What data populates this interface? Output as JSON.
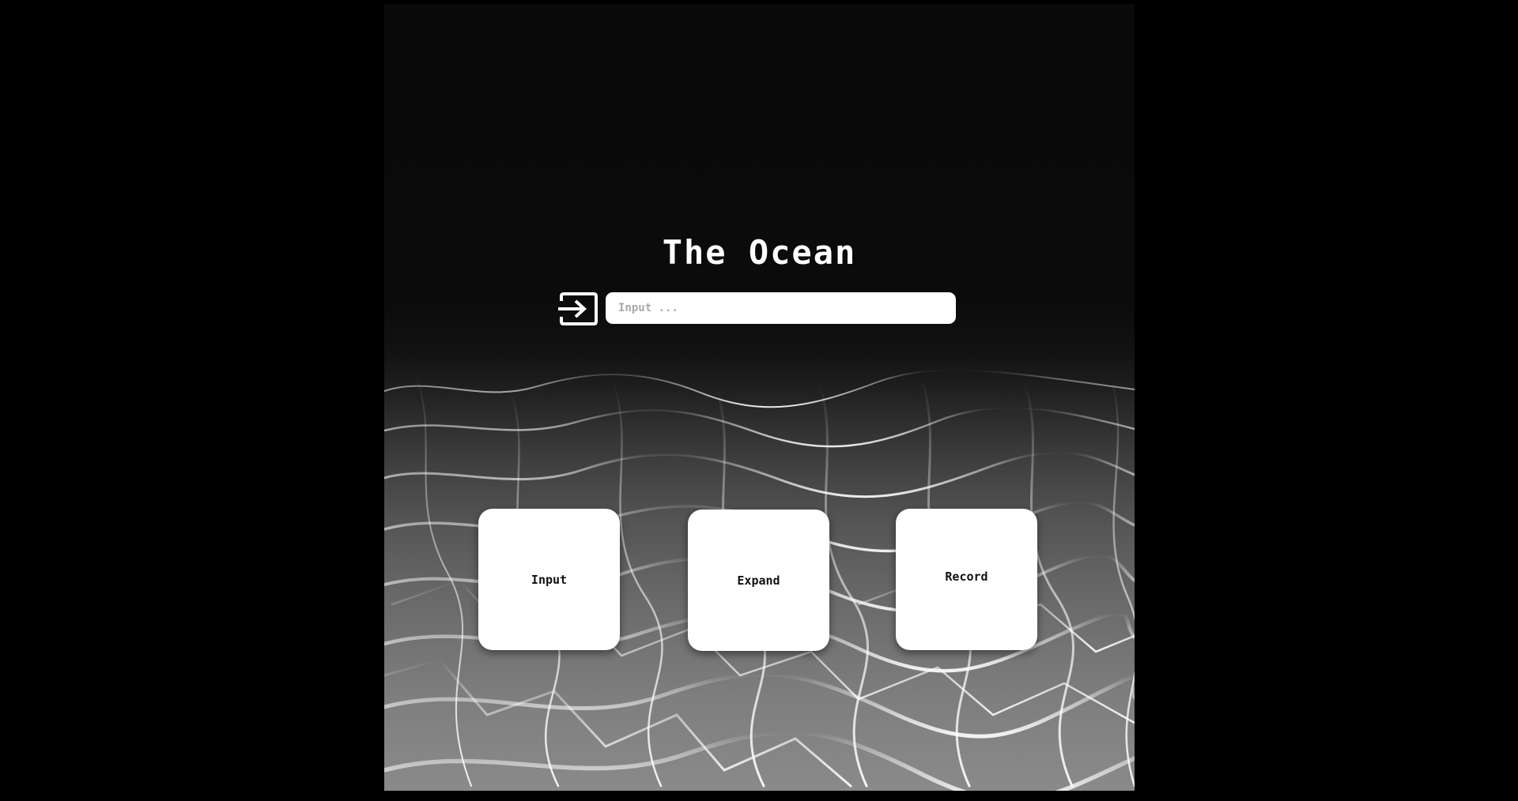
{
  "page": {
    "background_color": "#000000"
  },
  "header": {
    "title": "The Ocean"
  },
  "search": {
    "enter_icon": "enter-arrow-icon",
    "placeholder": "Input ...",
    "value": ""
  },
  "cards": {
    "input_label": "Input",
    "expand_label": "Expand",
    "record_label": "Record"
  },
  "colors": {
    "text_light": "#ffffff",
    "card_background": "#ffffff",
    "card_text": "#111111",
    "placeholder": "#a8a8a8"
  }
}
